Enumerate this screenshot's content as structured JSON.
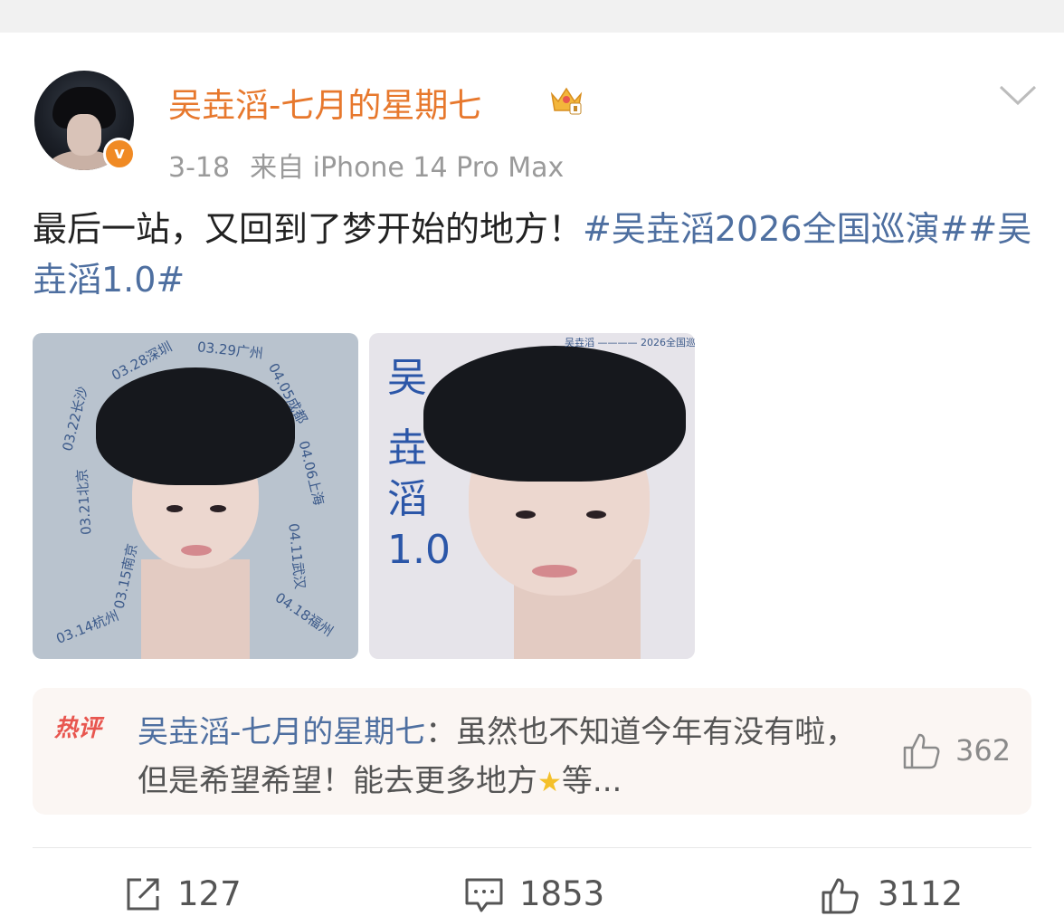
{
  "post": {
    "username": "吴垚滔-七月的星期七",
    "verified_badge": "v",
    "date": "3-18",
    "source": "来自 iPhone 14 Pro Max",
    "text": "最后一站，又回到了梦开始的地方！",
    "topics": [
      "#吴垚滔2026全国巡演#",
      "#吴垚滔1.0#"
    ],
    "crown_icon": "crown-icon",
    "menu_icon": "chevron-down-icon"
  },
  "images": {
    "poster1_cities": [
      "03.28深圳",
      "03.29广州",
      "04.05成都",
      "03.22长沙",
      "04.06上海",
      "03.21北京",
      "04.11武汉",
      "03.15南京",
      "04.18福州",
      "03.14杭州"
    ],
    "poster2_title": [
      "吴",
      "垚",
      "滔",
      "1.0"
    ],
    "poster2_top": "吴垚滔 ———— 2026全国巡演"
  },
  "hot_comment": {
    "badge": "热评",
    "author": "吴垚滔-七月的星期七",
    "separator": "：",
    "text_part1": "虽然也不知道今年有没有啦，但是希望希望！能去更多地方",
    "text_part2": "等...",
    "likes": "362"
  },
  "actions": {
    "reposts": "127",
    "comments": "1853",
    "likes": "3112"
  },
  "colors": {
    "username": "#e7782d",
    "topic": "#4e6fa0",
    "hot_badge": "#e8564f"
  }
}
